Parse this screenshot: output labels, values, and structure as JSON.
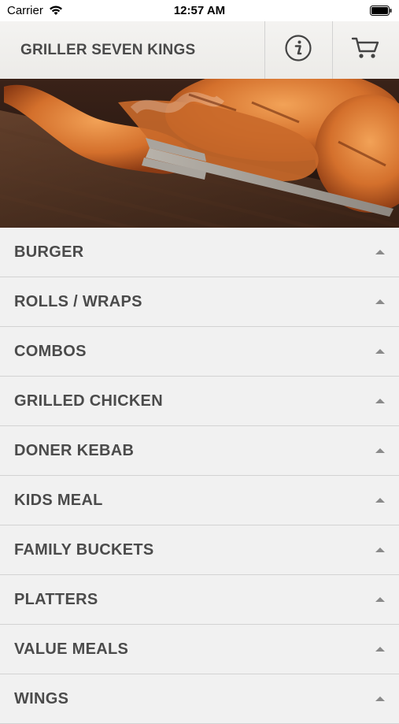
{
  "status_bar": {
    "carrier": "Carrier",
    "time": "12:57 AM",
    "icons": [
      "wifi-icon",
      "battery-icon"
    ]
  },
  "header": {
    "title": "GRILLER SEVEN KINGS",
    "icons": [
      "info-icon",
      "cart-icon"
    ]
  },
  "hero": {
    "image": "grilled-chicken-photo"
  },
  "menu": {
    "items": [
      {
        "label": "BURGER"
      },
      {
        "label": "ROLLS / WRAPS"
      },
      {
        "label": "COMBOS"
      },
      {
        "label": "GRILLED CHICKEN"
      },
      {
        "label": "DONER KEBAB"
      },
      {
        "label": "KIDS MEAL"
      },
      {
        "label": "FAMILY BUCKETS"
      },
      {
        "label": "PLATTERS"
      },
      {
        "label": "VALUE MEALS"
      },
      {
        "label": "WINGS"
      }
    ],
    "indicator_icon": "caret-up-icon"
  },
  "colors": {
    "background": "#f1f1f1",
    "text": "#4b4b4b",
    "divider": "#d3d3d3"
  }
}
